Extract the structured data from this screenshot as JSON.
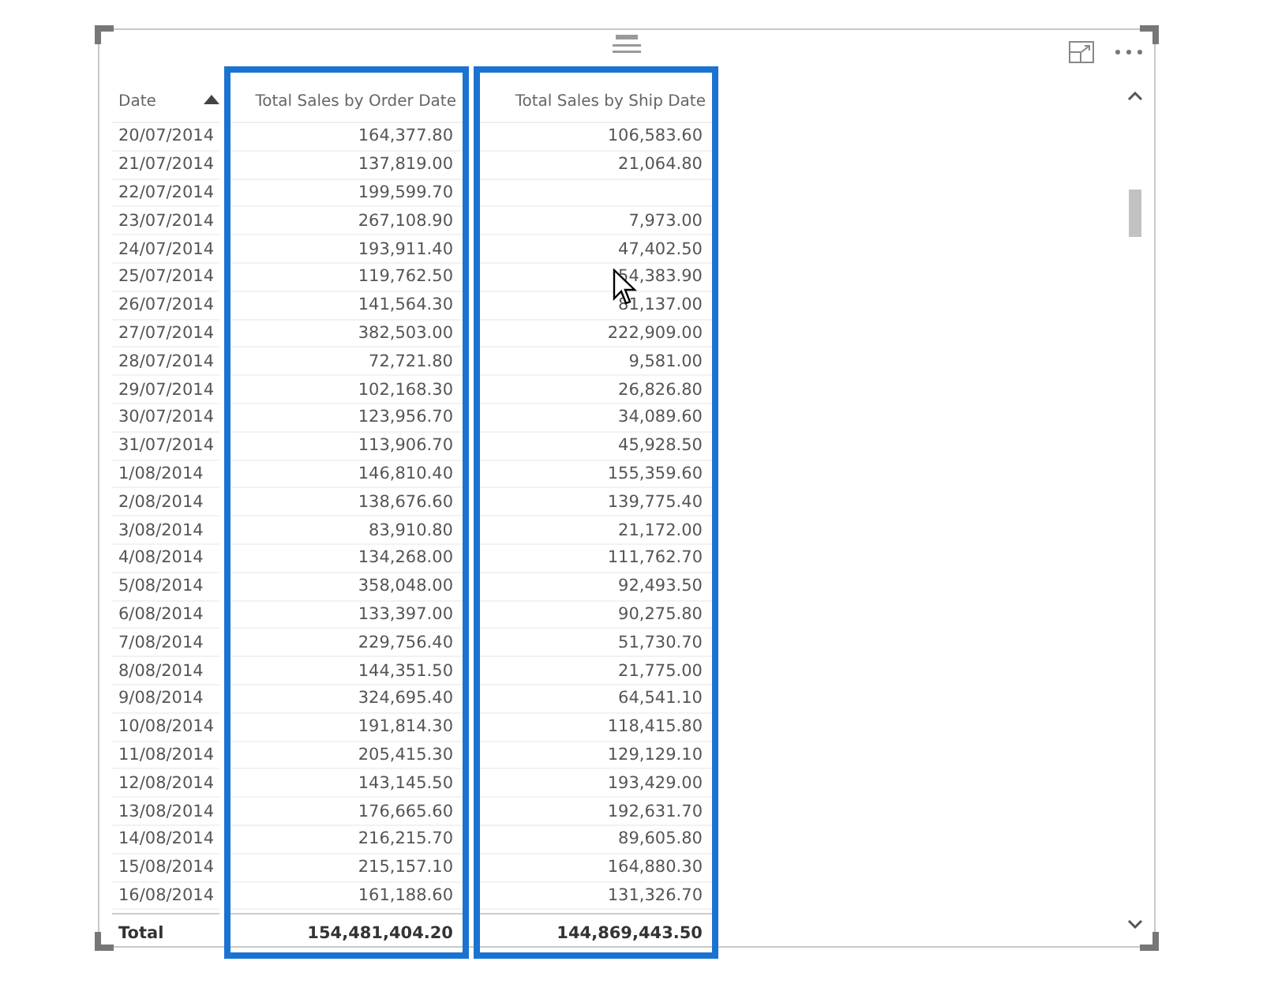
{
  "table": {
    "columns": [
      {
        "label": "Date",
        "sorted": true,
        "highlighted": false
      },
      {
        "label": "Total Sales by Order Date",
        "sorted": false,
        "highlighted": true
      },
      {
        "label": "Total Sales by Ship Date",
        "sorted": false,
        "highlighted": true
      }
    ],
    "rows": [
      [
        "20/07/2014",
        "164,377.80",
        "106,583.60"
      ],
      [
        "21/07/2014",
        "137,819.00",
        "21,064.80"
      ],
      [
        "22/07/2014",
        "199,599.70",
        null
      ],
      [
        "23/07/2014",
        "267,108.90",
        "7,973.00"
      ],
      [
        "24/07/2014",
        "193,911.40",
        "47,402.50"
      ],
      [
        "25/07/2014",
        "119,762.50",
        "54,383.90"
      ],
      [
        "26/07/2014",
        "141,564.30",
        "81,137.00"
      ],
      [
        "27/07/2014",
        "382,503.00",
        "222,909.00"
      ],
      [
        "28/07/2014",
        "72,721.80",
        "9,581.00"
      ],
      [
        "29/07/2014",
        "102,168.30",
        "26,826.80"
      ],
      [
        "30/07/2014",
        "123,956.70",
        "34,089.60"
      ],
      [
        "31/07/2014",
        "113,906.70",
        "45,928.50"
      ],
      [
        "1/08/2014",
        "146,810.40",
        "155,359.60"
      ],
      [
        "2/08/2014",
        "138,676.60",
        "139,775.40"
      ],
      [
        "3/08/2014",
        "83,910.80",
        "21,172.00"
      ],
      [
        "4/08/2014",
        "134,268.00",
        "111,762.70"
      ],
      [
        "5/08/2014",
        "358,048.00",
        "92,493.50"
      ],
      [
        "6/08/2014",
        "133,397.00",
        "90,275.80"
      ],
      [
        "7/08/2014",
        "229,756.40",
        "51,730.70"
      ],
      [
        "8/08/2014",
        "144,351.50",
        "21,775.00"
      ],
      [
        "9/08/2014",
        "324,695.40",
        "64,541.10"
      ],
      [
        "10/08/2014",
        "191,814.30",
        "118,415.80"
      ],
      [
        "11/08/2014",
        "205,415.30",
        "129,129.10"
      ],
      [
        "12/08/2014",
        "143,145.50",
        "193,429.00"
      ],
      [
        "13/08/2014",
        "176,665.60",
        "192,631.70"
      ],
      [
        "14/08/2014",
        "216,215.70",
        "89,605.80"
      ],
      [
        "15/08/2014",
        "215,157.10",
        "164,880.30"
      ],
      [
        "16/08/2014",
        "161,188.60",
        "131,326.70"
      ]
    ],
    "totals": [
      "Total",
      "154,481,404.20",
      "144,869,443.50"
    ]
  }
}
